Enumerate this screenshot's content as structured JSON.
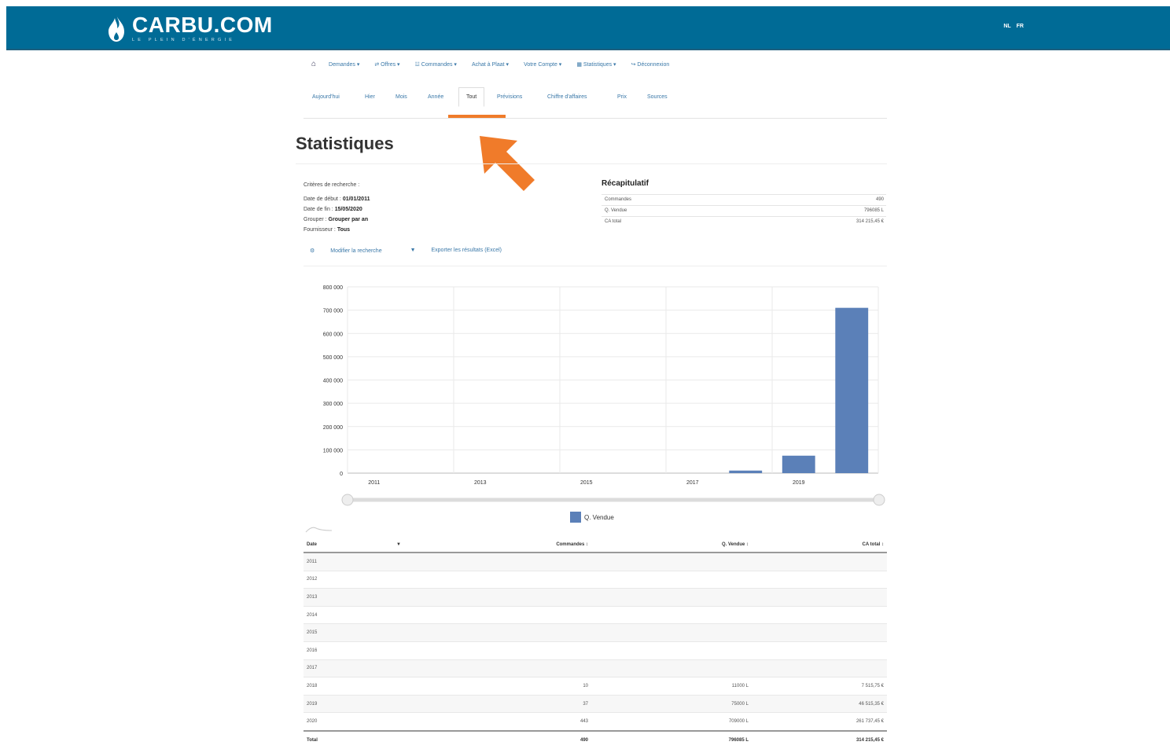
{
  "header": {
    "logo_main": "CARBU.COM",
    "logo_tagline": "LE PLEIN D'ÉNERGIE",
    "lang": [
      "NL",
      "FR"
    ]
  },
  "nav": {
    "items": [
      "Demandes ▾",
      "Offres ▾",
      "Commandes ▾",
      "Achat à Plaat ▾",
      "Votre Compte ▾",
      "Statistiques ▾",
      "Déconnexion"
    ]
  },
  "tabs": {
    "items": [
      "Aujourd'hui",
      "Hier",
      "Mois",
      "Année",
      "Tout",
      "Prévisions",
      "Chiffre d'affaires",
      "Prix",
      "Sources"
    ],
    "active": "Tout"
  },
  "page": {
    "title": "Statistiques"
  },
  "criteria": {
    "heading": "Critères de recherche :",
    "rows": [
      {
        "label": "Date de début :",
        "value": "01/01/2011"
      },
      {
        "label": "Date de fin :",
        "value": "15/05/2020"
      },
      {
        "label": "Grouper :",
        "value": "Grouper par an"
      },
      {
        "label": "Fournisseur :",
        "value": "Tous"
      }
    ]
  },
  "recap": {
    "title": "Récapitulatif",
    "rows": [
      {
        "label": "Commandes",
        "value": "490"
      },
      {
        "label": "Q. Vendue",
        "value": "796085 L"
      },
      {
        "label": "CA total",
        "value": "314 215,45 €"
      }
    ]
  },
  "actions": {
    "modify": "Modifier la recherche",
    "export": "Exporter les résultats (Excel)"
  },
  "chart_data": {
    "type": "bar",
    "categories": [
      "2011",
      "2012",
      "2013",
      "2014",
      "2015",
      "2016",
      "2017",
      "2018",
      "2019",
      "2020"
    ],
    "x_tick_labels": [
      "2011",
      "2013",
      "2015",
      "2017",
      "2019"
    ],
    "series": [
      {
        "name": "Q. Vendue",
        "values": [
          0,
          0,
          0,
          0,
          0,
          0,
          0,
          11000,
          75000,
          710000
        ]
      }
    ],
    "y_ticks": [
      "0",
      "100 000",
      "200 000",
      "300 000",
      "400 000",
      "500 000",
      "600 000",
      "700 000",
      "800 000"
    ],
    "ylim": [
      0,
      800000
    ],
    "grid": true,
    "legend": "bottom",
    "color": "#5b80b8"
  },
  "table": {
    "headers": [
      "Date",
      "Commandes",
      "Q. Vendue",
      "CA total"
    ],
    "rows": [
      [
        "2011",
        "",
        "",
        ""
      ],
      [
        "2012",
        "",
        "",
        ""
      ],
      [
        "2013",
        "",
        "",
        ""
      ],
      [
        "2014",
        "",
        "",
        ""
      ],
      [
        "2015",
        "",
        "",
        ""
      ],
      [
        "2016",
        "",
        "",
        ""
      ],
      [
        "2017",
        "",
        "",
        ""
      ],
      [
        "2018",
        "10",
        "11000 L",
        "7 515,75 €"
      ],
      [
        "2019",
        "37",
        "75000 L",
        "46 515,35 €"
      ],
      [
        "2020",
        "443",
        "709000 L",
        "261 737,45 €"
      ]
    ],
    "total": [
      "Total",
      "490",
      "796085 L",
      "314 215,45 €"
    ]
  },
  "colors": {
    "header_bg": "#006b96",
    "accent_orange": "#f07b2a",
    "link": "#3a78a8",
    "bar": "#5b80b8"
  }
}
